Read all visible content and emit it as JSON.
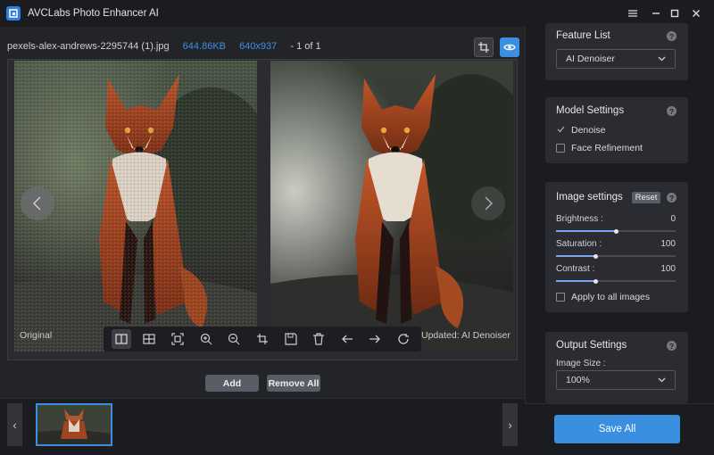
{
  "app": {
    "title": "AVCLabs Photo Enhancer AI"
  },
  "file": {
    "name": "pexels-alex-andrews-2295744 (1).jpg",
    "size": "644.86KB",
    "dimensions": "640x937",
    "counter": "- 1 of 1"
  },
  "preview": {
    "original_label": "Original",
    "updated_label": "Updated: AI Denoiser"
  },
  "actions": {
    "add": "Add",
    "remove_all": "Remove All"
  },
  "feature_list": {
    "title": "Feature List",
    "selected": "AI Denoiser"
  },
  "model_settings": {
    "title": "Model Settings",
    "options": [
      {
        "label": "Denoise",
        "checked": true
      },
      {
        "label": "Face Refinement",
        "checked": false
      }
    ]
  },
  "image_settings": {
    "title": "Image settings",
    "reset": "Reset",
    "sliders": [
      {
        "label": "Brightness :",
        "value": "0",
        "fraction": 0.5
      },
      {
        "label": "Saturation :",
        "value": "100",
        "fraction": 0.33
      },
      {
        "label": "Contrast :",
        "value": "100",
        "fraction": 0.33
      }
    ],
    "apply_all": "Apply to all images"
  },
  "output_settings": {
    "title": "Output Settings",
    "size_label": "Image Size :",
    "size_value": "100%"
  },
  "save_all": "Save All",
  "colors": {
    "accent": "#3a8fe0",
    "file_info": "#3d8fe6"
  }
}
